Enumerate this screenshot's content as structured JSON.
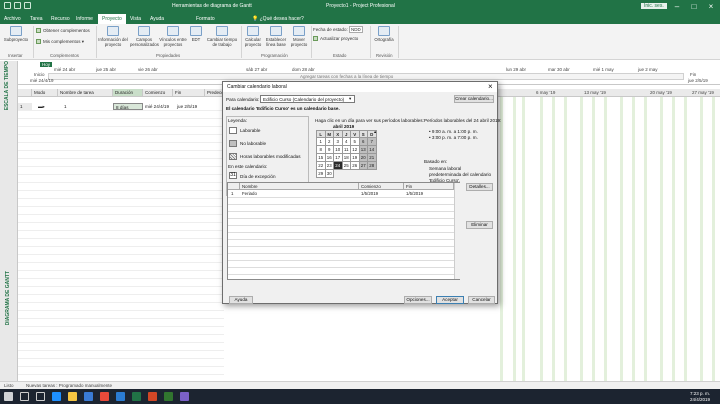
{
  "window": {
    "title_left": "Herramientas de diagrama de Gantt",
    "title_center": "Proyecto1 - Project Profesional",
    "user": "Inic. ses."
  },
  "tabs": [
    "Archivo",
    "Tarea",
    "Recurso",
    "Informe",
    "Proyecto",
    "Vista",
    "Ayuda",
    "Formato"
  ],
  "tell_me": "¿Qué desea hacer?",
  "ribbon": {
    "subproject": "Subproyecto",
    "get_addins": "Obtener complementos",
    "my_addins": "Mis complementos",
    "project_info": "Información del proyecto",
    "custom_fields": "Campos personalizados",
    "links": "Vínculos entre proyectos",
    "wbs": "EDT",
    "change_worktime": "Cambiar tiempo de trabajo",
    "calculate": "Calcular proyecto",
    "set_baseline": "Establecer línea base",
    "move_project": "Mover proyecto",
    "status_date_label": "Fecha de estado:",
    "status_date_value": "NDD",
    "update_project": "Actualizar proyecto",
    "spelling": "Ortografía",
    "groups": [
      "Insertar",
      "Complementos",
      "Propiedades",
      "Programación",
      "Estado",
      "Revisión"
    ]
  },
  "timeline": {
    "label": "ESCALA DE TIEMPO",
    "today": "Hoy",
    "start_label": "Inicio",
    "start_date": "mié 24/4/19",
    "end_label": "Fin",
    "end_date": "jue 2/5/19",
    "hint": "Agregar tareas con fechas a la línea de tiempo",
    "dates": [
      "mié 24 abr",
      "jue 25 abr",
      "vie 26 abr",
      "sáb 27 abr",
      "dom 28 abr",
      "lun 29 abr",
      "mar 30 abr",
      "mié 1 may",
      "jue 2 may"
    ]
  },
  "grid": {
    "headers": [
      "Modo",
      "Nombre de tarea",
      "Duración",
      "Comienzo",
      "Fin",
      "Predecesoras"
    ],
    "row": {
      "num": "1",
      "name": "1",
      "duration": "8 días",
      "start": "mié 24/4/19",
      "finish": "jue 2/5/19"
    }
  },
  "gantt_view_label": "DIAGRAMA DE GANTT",
  "gantt_dates": [
    "6 may '19",
    "13 may '19",
    "20 may '19",
    "27 may '19"
  ],
  "dialog": {
    "title": "Cambiar calendario laboral",
    "for_calendar_label": "Para calendario:",
    "calendar_value": "Edificio Curso (Calendario del proyecto)",
    "create_calendar": "Crear calendario...",
    "base_info": "El calendario 'Edificio Curso' es un calendario base.",
    "legend_title": "Leyenda:",
    "legend": [
      "Laborable",
      "No laborable",
      "Horas laborables modificadas"
    ],
    "on_this_calendar": "En este calendario:",
    "legend2": [
      "Día de excepción",
      "Semana laboral no predeterminada"
    ],
    "click_hint": "Haga clic en un día para ver sus períodos laborables:",
    "month": "abril 2019",
    "weekdays": [
      "L",
      "M",
      "X",
      "J",
      "V",
      "S",
      "D"
    ],
    "work_periods_title": "Períodos laborables del 24 abril 2019:",
    "periods": [
      "• 9:00 a. m. a 1:00 p. m.",
      "• 3:00 p. m. a 7:00 p. m."
    ],
    "based_on": "Basado en:",
    "based_detail": "Semana laboral predeterminada del calendario 'Edificio Curso'.",
    "tabs": [
      "Excepciones",
      "Semanas laborales"
    ],
    "table_headers": [
      "Nombre",
      "Comienzo",
      "Fin"
    ],
    "exception": {
      "num": "1",
      "name": "Feriado",
      "start": "1/5/2019",
      "finish": "1/5/2019"
    },
    "details": "Detalles...",
    "delete": "Eliminar",
    "help": "Ayuda",
    "options": "Opciones...",
    "ok": "Aceptar",
    "cancel": "Cancelar"
  },
  "status": {
    "ready": "Listo",
    "new_tasks": "Nuevas tareas : Programado manualmente"
  },
  "clock": {
    "time": "7:23 p. m.",
    "date": "24/4/2019"
  }
}
